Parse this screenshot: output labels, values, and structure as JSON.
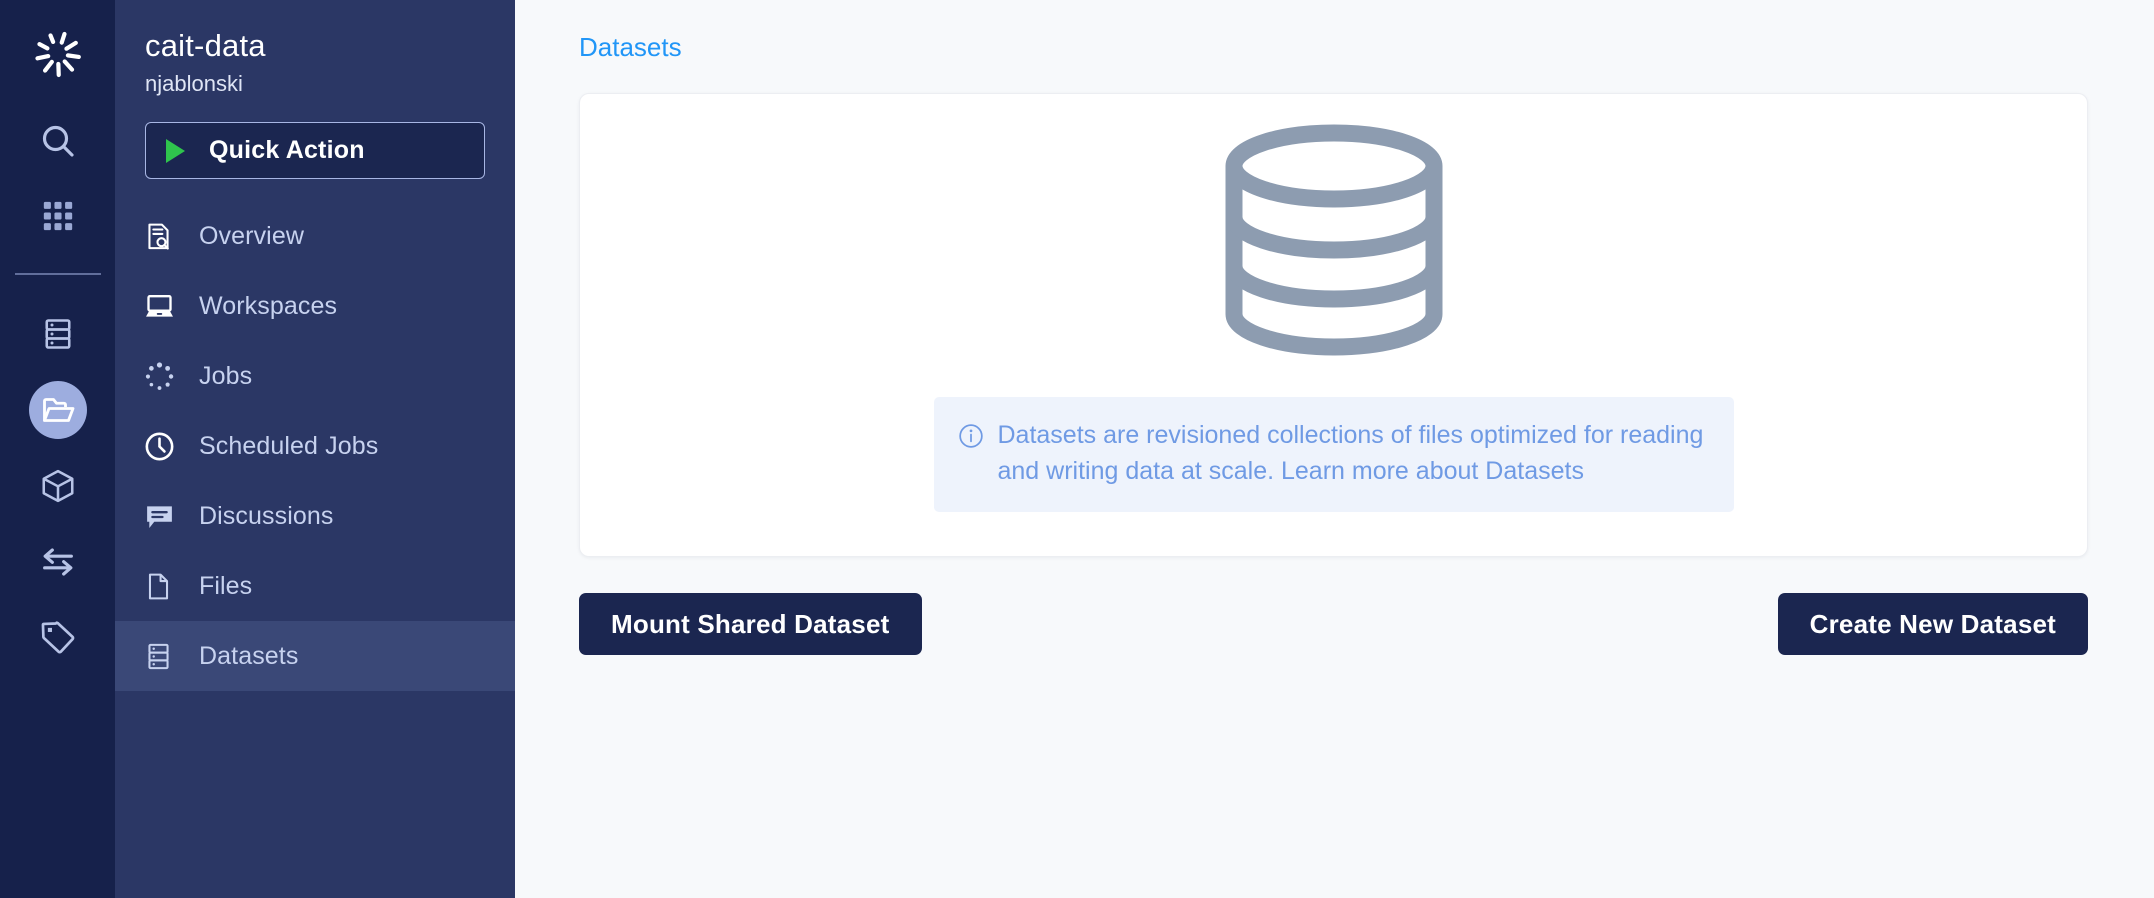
{
  "rail": {
    "logo_name": "domino-aperture-logo",
    "items": [
      {
        "name": "search-icon",
        "active": false
      },
      {
        "name": "apps-grid-icon",
        "active": false
      },
      {
        "name": "server-stack-icon",
        "active": false
      },
      {
        "name": "folder-open-icon",
        "active": true
      },
      {
        "name": "package-cube-icon",
        "active": false
      },
      {
        "name": "transfer-arrows-icon",
        "active": false
      },
      {
        "name": "tag-icon",
        "active": false
      }
    ]
  },
  "sidebar": {
    "project_name": "cait-data",
    "project_owner": "njablonski",
    "quick_action_label": "Quick Action",
    "items": [
      {
        "label": "Overview",
        "icon": "document-search-icon",
        "active": false
      },
      {
        "label": "Workspaces",
        "icon": "laptop-icon",
        "active": false
      },
      {
        "label": "Jobs",
        "icon": "spinner-dots-icon",
        "active": false
      },
      {
        "label": "Scheduled Jobs",
        "icon": "clock-icon",
        "active": false
      },
      {
        "label": "Discussions",
        "icon": "comment-icon",
        "active": false
      },
      {
        "label": "Files",
        "icon": "file-icon",
        "active": false
      },
      {
        "label": "Datasets",
        "icon": "dataset-stack-icon",
        "active": true
      }
    ]
  },
  "main": {
    "breadcrumb": "Datasets",
    "empty_illustration": "database-cylinder-icon",
    "info": {
      "icon": "info-circle-icon",
      "text": "Datasets are revisioned collections of files optimized for reading and writing data at scale. Learn more about Datasets"
    },
    "mount_button_label": "Mount Shared Dataset",
    "create_button_label": "Create New Dataset"
  },
  "colors": {
    "rail_bg": "#16214b",
    "panel_bg": "#2b3765",
    "nav_active_bg": "#3a4877",
    "rail_active_bg": "#9daddf",
    "accent_link": "#2196f7",
    "play_green": "#2fc44d",
    "button_navy": "#1b2650",
    "info_bg": "#eef3fc",
    "info_text": "#6f9ae4",
    "illustration": "#8d9cb0",
    "page_bg": "#f7f9fb"
  }
}
